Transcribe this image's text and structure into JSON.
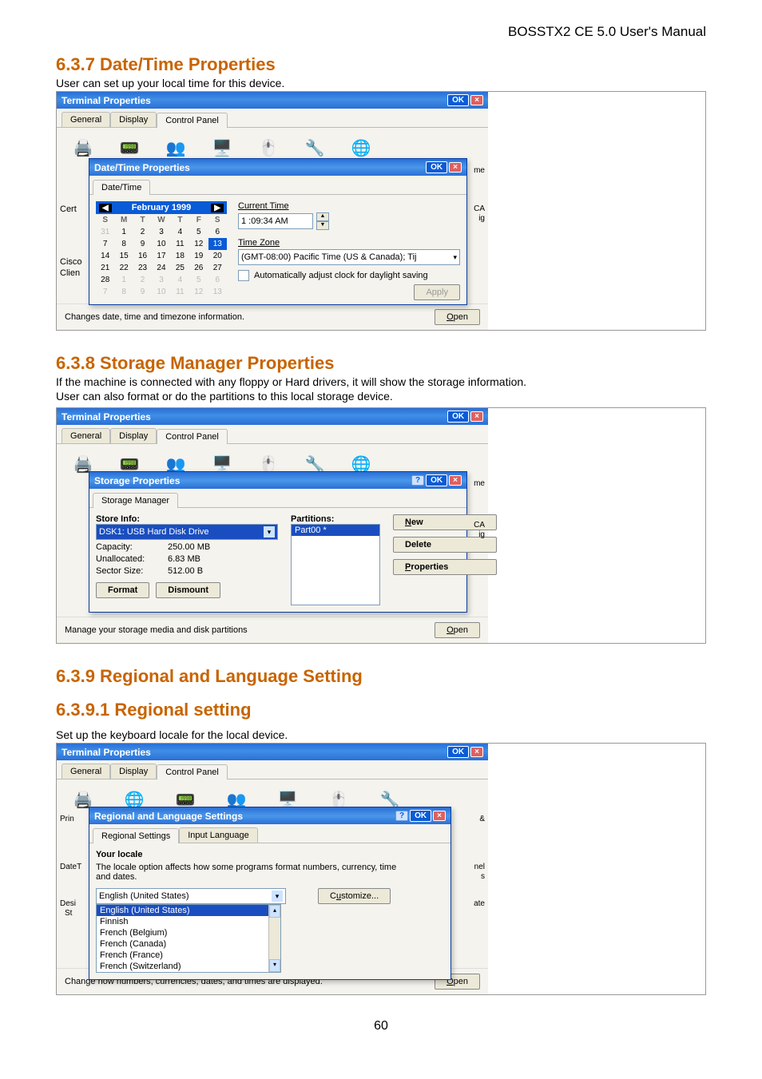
{
  "doc": {
    "header": "BOSSTX2 CE 5.0 User's Manual",
    "page_number": "60"
  },
  "sections": {
    "datetime": {
      "heading": "6.3.7  Date/Time Properties",
      "intro": "User can set up your local time for this device.",
      "terminal_title": "Terminal Properties",
      "terminal_tabs": [
        "General",
        "Display",
        "Control Panel"
      ],
      "terminal_tab_selected": "Control Panel",
      "left_labels": {
        "cert": "Cert",
        "cisco": "Cisco",
        "clien": "Clien"
      },
      "dialog_title": "Date/Time Properties",
      "dialog_tab": "Date/Time",
      "calendar": {
        "month_label": "February 1999",
        "daynames": [
          "S",
          "M",
          "T",
          "W",
          "T",
          "F",
          "S"
        ],
        "rows": [
          [
            "31",
            "1",
            "2",
            "3",
            "4",
            "5",
            "6"
          ],
          [
            "7",
            "8",
            "9",
            "10",
            "11",
            "12",
            "13"
          ],
          [
            "14",
            "15",
            "16",
            "17",
            "18",
            "19",
            "20"
          ],
          [
            "21",
            "22",
            "23",
            "24",
            "25",
            "26",
            "27"
          ],
          [
            "28",
            "1",
            "2",
            "3",
            "4",
            "5",
            "6"
          ],
          [
            "7",
            "8",
            "9",
            "10",
            "11",
            "12",
            "13"
          ]
        ],
        "other_month_cells": [
          "0,0",
          "4,1",
          "4,2",
          "4,3",
          "4,4",
          "4,5",
          "4,6",
          "5,0",
          "5,1",
          "5,2",
          "5,3",
          "5,4",
          "5,5",
          "5,6"
        ],
        "selected_cell": "1,6"
      },
      "current_time_label": "Current Time",
      "current_time_value": "1 :09:34 AM",
      "time_zone_label": "Time Zone",
      "time_zone_value": "(GMT-08:00) Pacific Time (US & Canada); Tij",
      "dst_checkbox": "Automatically adjust clock for daylight saving",
      "apply_btn": "Apply",
      "status_text": "Changes date, time and timezone information.",
      "open_btn": "Open",
      "right_edge_hint": {
        "ca": "CA",
        "ig": "ig",
        "me": "me"
      }
    },
    "storage": {
      "heading": "6.3.8  Storage Manager Properties",
      "intro1": "If the machine is connected with any floppy or Hard drivers, it will show the storage information.",
      "intro2": "User can also format or do the partitions to this local storage device.",
      "terminal_title": "Terminal Properties",
      "terminal_tabs": [
        "General",
        "Display",
        "Control Panel"
      ],
      "terminal_tab_selected": "Control Panel",
      "dialog_title": "Storage Properties",
      "dialog_tab": "Storage Manager",
      "store_info_label": "Store Info:",
      "store_combo": "DSK1: USB Hard Disk Drive",
      "capacity_k": "Capacity:",
      "capacity_v": "250.00 MB",
      "unallocated_k": "Unallocated:",
      "unallocated_v": "6.83 MB",
      "sector_k": "Sector Size:",
      "sector_v": "512.00 B",
      "format_btn": "Format",
      "dismount_btn": "Dismount",
      "partitions_label": "Partitions:",
      "partition_selected": "Part00 *",
      "new_btn": "New",
      "delete_btn": "Delete",
      "properties_btn": "Properties",
      "status_text": "Manage your storage media and disk partitions",
      "open_btn": "Open",
      "right_edge_hint": {
        "ca": "CA",
        "ig": "ig",
        "me": "me"
      }
    },
    "regional": {
      "heading_a": "6.3.9  Regional and Language Setting",
      "heading_b": "6.3.9.1 Regional setting",
      "intro": "Set up the keyboard locale for the local device.",
      "terminal_title": "Terminal Properties",
      "terminal_tabs": [
        "General",
        "Display",
        "Control Panel"
      ],
      "terminal_tab_selected": "Control Panel",
      "dialog_title": "Regional and Language Settings",
      "dialog_tabs": [
        "Regional Settings",
        "Input Language"
      ],
      "dialog_tab_selected": "Regional Settings",
      "your_locale": "Your locale",
      "locale_hint": "The locale option affects how some programs format numbers, currency, time and dates.",
      "combo_value": "English (United States)",
      "listbox": [
        "English (United States)",
        "Finnish",
        "French (Belgium)",
        "French (Canada)",
        "French (France)",
        "French (Switzerland)"
      ],
      "listbox_selected_index": 0,
      "customize_btn": "Customize...",
      "status_text": "Change how numbers, currencies, dates, and times are displayed.",
      "open_btn": "Open",
      "left_labels": {
        "prin": "Prin",
        "dater": "DateT",
        "desi": "Desi",
        "st": "St"
      },
      "right_edge_hint": {
        "nel": "nel",
        "s": "s",
        "ate": "ate",
        "amp": "&"
      }
    }
  },
  "common": {
    "ok": "OK",
    "close": "×",
    "help": "?"
  }
}
